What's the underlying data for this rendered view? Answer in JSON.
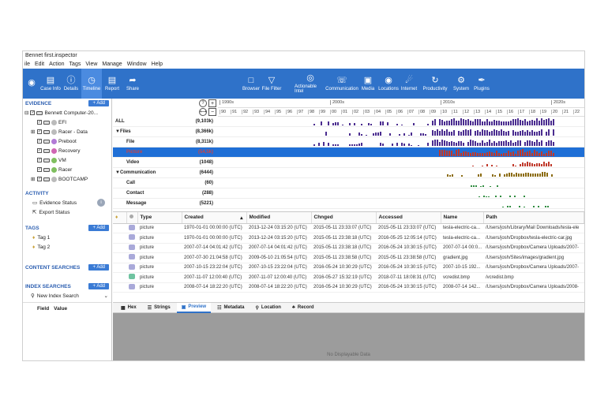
{
  "window": {
    "title": "Bennet first.inspector"
  },
  "menu": [
    "ile",
    "Edit",
    "Action",
    "Tags",
    "View",
    "Manage",
    "Window",
    "Help"
  ],
  "toolbar": {
    "left": [
      {
        "label": "Case Info",
        "icon": "document-icon"
      },
      {
        "label": "Details",
        "icon": "info-icon"
      },
      {
        "label": "Timeline",
        "icon": "clock-icon"
      },
      {
        "label": "Report",
        "icon": "report-icon"
      },
      {
        "label": "Share",
        "icon": "share-icon"
      }
    ],
    "right": [
      {
        "label": "Browser",
        "icon": "folder-icon"
      },
      {
        "label": "File Filter",
        "icon": "filter-icon"
      },
      {
        "label": "Actionable Intel",
        "icon": "target-icon"
      },
      {
        "label": "Communication",
        "icon": "phone-icon"
      },
      {
        "label": "Media",
        "icon": "image-icon"
      },
      {
        "label": "Locations",
        "icon": "pin-icon"
      },
      {
        "label": "Internet",
        "icon": "globe-icon"
      },
      {
        "label": "Productivity",
        "icon": "refresh-icon"
      },
      {
        "label": "System",
        "icon": "gear-icon"
      },
      {
        "label": "Plugins",
        "icon": "plug-icon"
      }
    ]
  },
  "sidebar": {
    "evidence": {
      "title": "EVIDENCE",
      "add": "+ Add",
      "root": "Bennett Computer-20...",
      "items": [
        {
          "label": "EFI",
          "color": "#bbbbbb"
        },
        {
          "label": "Racer - Data",
          "color": "#bbbbbb"
        },
        {
          "label": "Preboot",
          "color": "#b27ad6"
        },
        {
          "label": "Recovery",
          "color": "#d066b3"
        },
        {
          "label": "VM",
          "color": "#7fbf5f"
        },
        {
          "label": "Racer",
          "color": "#7fbf5f"
        },
        {
          "label": "BOOTCAMP",
          "color": "#bbbbbb"
        }
      ]
    },
    "activity": {
      "title": "ACTIVITY",
      "items": [
        "Evidence Status",
        "Export Status"
      ],
      "badge": "i"
    },
    "tags": {
      "title": "TAGS",
      "add": "+ Add",
      "items": [
        "Tag 1",
        "Tag 2"
      ]
    },
    "content_searches": {
      "title": "CONTENT SEARCHES",
      "add": "+ Add"
    },
    "index_searches": {
      "title": "INDEX SEARCHES",
      "add": "+ Add",
      "new": "New Index Search"
    },
    "fields": {
      "field": "Field",
      "value": "Value"
    }
  },
  "timeline": {
    "rows": [
      {
        "label": "ALL",
        "count": "(9,103k)"
      },
      {
        "label": "▼Files",
        "count": "(8,366k)"
      },
      {
        "label": "File",
        "count": "(8,311k)"
      },
      {
        "label": "Picture",
        "count": "(54,5k)"
      },
      {
        "label": "Video",
        "count": "(1048)"
      },
      {
        "label": "▼Communication",
        "count": "(6444)"
      },
      {
        "label": "Call",
        "count": "(60)"
      },
      {
        "label": "Contact",
        "count": "(288)"
      },
      {
        "label": "Message",
        "count": "(5221)"
      }
    ],
    "decades": [
      "1990s",
      "2000s",
      "2010s",
      "2020s"
    ],
    "years": [
      "90",
      "91",
      "92",
      "93",
      "94",
      "95",
      "96",
      "97",
      "98",
      "99",
      "00",
      "01",
      "02",
      "03",
      "04",
      "05",
      "06",
      "07",
      "08",
      "09",
      "10",
      "11",
      "12",
      "13",
      "14",
      "15",
      "16",
      "17",
      "18",
      "19",
      "20",
      "21",
      "22",
      "23"
    ],
    "zoom_in": "+",
    "zoom_out": "−",
    "help": "?",
    "fit": "⟷"
  },
  "grid": {
    "columns": [
      "Type",
      "Created",
      "Modified",
      "Chnged",
      "Accessed",
      "Name",
      "Path"
    ],
    "rows": [
      [
        "picture",
        "1970-01-01 00:00:00 (UTC)",
        "2013-12-24 03:15:20 (UTC)",
        "2015-05-11 23:33:07 (UTC)",
        "2015-05-11 23:33:07 (UTC)",
        "tesla-electric-ca...",
        "/Users/josh/Library/Mail Downloads/tesla-ele"
      ],
      [
        "picture",
        "1970-01-01 00:00:00 (UTC)",
        "2013-12-24 03:15:20 (UTC)",
        "2015-05-11 23:38:18 (UTC)",
        "2016-05-25 12:05:14 (UTC)",
        "tesla-electric-ca...",
        "/Users/josh/Dropbox/tesla-electric-car.jpg"
      ],
      [
        "picture",
        "2007-07-14 04:01:42 (UTC)",
        "2007-07-14 04:01:42 (UTC)",
        "2015-05-11 23:38:18 (UTC)",
        "2016-05-24 10:30:15 (UTC)",
        "2007-07-14 00:0...",
        "/Users/josh/Dropbox/Camera Uploads/2007-"
      ],
      [
        "picture",
        "2007-07-30 21:04:58 (UTC)",
        "2009-05-10 21:05:54 (UTC)",
        "2015-05-11 23:38:58 (UTC)",
        "2015-05-11 23:38:58 (UTC)",
        "gradient.jpg",
        "/Users/josh/Sites/images/gradient.jpg"
      ],
      [
        "picture",
        "2007-10-15 23:22:04 (UTC)",
        "2007-10-15 23:22:04 (UTC)",
        "2016-05-24 10:30:29 (UTC)",
        "2016-05-24 10:30:15 (UTC)",
        "2007-10-15 192...",
        "/Users/josh/Dropbox/Camera Uploads/2007-"
      ],
      [
        "picture",
        "2007-11-07 12:00:40 (UTC)",
        "2007-11-07 12:00:40 (UTC)",
        "2016-05-27 15:32:19 (UTC)",
        "2018-07-11 18:08:31 (UTC)",
        "vcredist.bmp",
        "/vcredist.bmp"
      ],
      [
        "picture",
        "2008-07-14 18:22:20 (UTC)",
        "2008-07-14 18:22:20 (UTC)",
        "2016-05-24 10:30:29 (UTC)",
        "2016-05-24 10:30:15 (UTC)",
        "2008-07-14 142...",
        "/Users/josh/Dropbox/Camera Uploads/2008-"
      ]
    ]
  },
  "tabs": [
    {
      "label": "Hex",
      "icon": "hex-icon"
    },
    {
      "label": "Strings",
      "icon": "strings-icon"
    },
    {
      "label": "Preview",
      "icon": "preview-icon",
      "active": true
    },
    {
      "label": "Metadata",
      "icon": "metadata-icon"
    },
    {
      "label": "Location",
      "icon": "pin-icon"
    },
    {
      "label": "Record",
      "icon": "record-icon"
    }
  ],
  "preview": {
    "message": "No Displayable Data"
  },
  "colors": {
    "accent": "#2f72c9",
    "selected": "#1f6fd6",
    "bars": "#4a2c8f",
    "picture_bars": "#c0392b"
  }
}
